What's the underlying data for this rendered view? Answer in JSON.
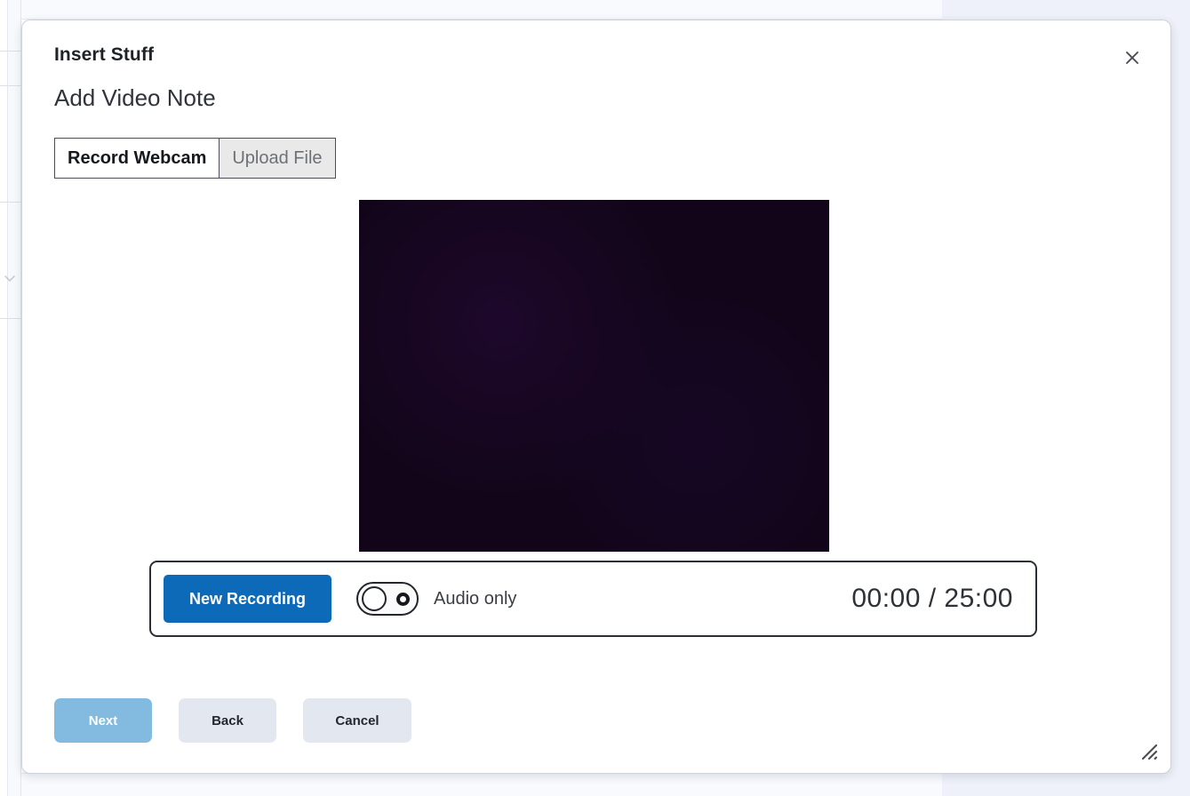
{
  "dialog": {
    "title": "Insert Stuff",
    "subtitle": "Add Video Note",
    "close_icon": "close-icon",
    "resize_icon": "resize-grip-icon"
  },
  "tabs": [
    {
      "label": "Record Webcam",
      "active": true
    },
    {
      "label": "Upload File",
      "active": false
    }
  ],
  "preview": {
    "name": "webcam-video-preview",
    "background_color": "#120519"
  },
  "controls": {
    "new_recording_label": "New Recording",
    "new_recording_color": "#0c6ab8",
    "audio_only_label": "Audio only",
    "audio_only_enabled": false,
    "timer_current": "00:00",
    "timer_separator": "/",
    "timer_max": "25:00",
    "timer_display": "00:00 / 25:00"
  },
  "footer": {
    "next_label": "Next",
    "next_disabled": true,
    "next_color": "#82bae0",
    "back_label": "Back",
    "cancel_label": "Cancel",
    "secondary_color": "#e3e8f0"
  },
  "background": {
    "chevron_icon": "chevron-down-icon",
    "rail_color": "#f7f9fc",
    "panel_color": "#eef1f9"
  }
}
